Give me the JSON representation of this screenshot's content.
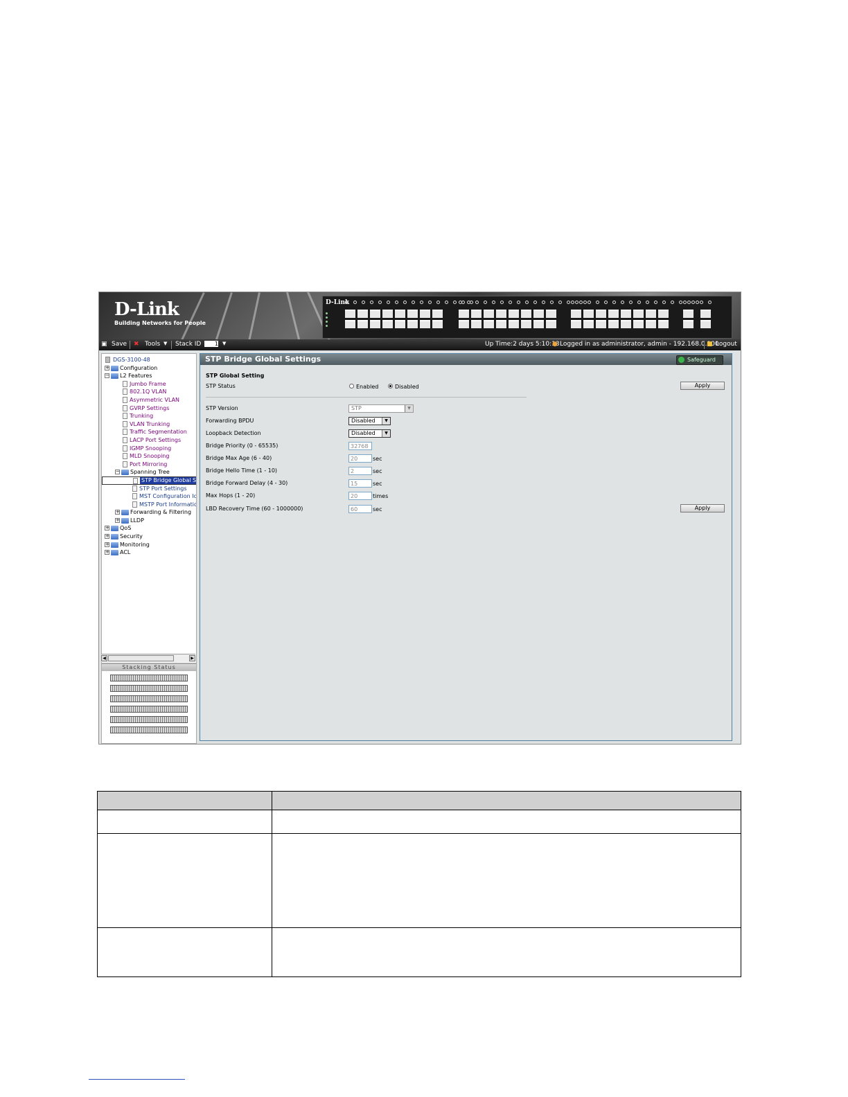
{
  "banner": {
    "logo": "D-Link",
    "tagline": "Building Networks for People",
    "device_brand": "D-Link"
  },
  "toolbar": {
    "save": "Save",
    "tools": "Tools",
    "stack_id_label": "Stack ID",
    "stack_id_value": "1",
    "uptime": "Up Time:2 days 5:10:13",
    "logged_in": "Logged in as administrator, admin - 192.168.0.100",
    "logout": "Logout"
  },
  "tree": {
    "root": "DGS-3100-48",
    "configuration": "Configuration",
    "l2features": "L2 Features",
    "jumbo": "Jumbo Frame",
    "vlan": "802.1Q VLAN",
    "asym": "Asymmetric VLAN",
    "gvrp": "GVRP Settings",
    "trunking": "Trunking",
    "vlantrunk": "VLAN Trunking",
    "traffic": "Traffic Segmentation",
    "lacp": "LACP Port Settings",
    "igmp": "IGMP Snooping",
    "mld": "MLD Snooping",
    "mirror": "Port Mirroring",
    "stp": "Spanning Tree",
    "stp_bridge": "STP Bridge Global Setti",
    "stp_port": "STP Port Settings",
    "mst_conf": "MST Configuration Ider",
    "mstp_port": "MSTP Port Information",
    "fwd": "Forwarding & Filtering",
    "lldp": "LLDP",
    "qos": "QoS",
    "security": "Security",
    "monitoring": "Monitoring",
    "acl": "ACL"
  },
  "stacking": {
    "header": "Stacking Status"
  },
  "panel": {
    "title": "STP Bridge Global Settings",
    "safeguard": "Safeguard",
    "section": "STP Global Setting",
    "status_label": "STP Status",
    "enabled": "Enabled",
    "disabled": "Disabled",
    "apply": "Apply",
    "version_label": "STP Version",
    "version_value": "STP",
    "fwd_bpdu_label": "Forwarding BPDU",
    "fwd_bpdu_value": "Disabled",
    "loopback_label": "Loopback Detection",
    "loopback_value": "Disabled",
    "priority_label": "Bridge Priority (0 - 65535)",
    "priority_value": "32768",
    "maxage_label": "Bridge Max Age (6 - 40)",
    "maxage_value": "20",
    "hello_label": "Bridge Hello Time (1 - 10)",
    "hello_value": "2",
    "fwddelay_label": "Bridge Forward  Delay (4 - 30)",
    "fwddelay_value": "15",
    "maxhops_label": "Max Hops (1 - 20)",
    "maxhops_value": "20",
    "lbd_label": "LBD Recovery Time (60 - 1000000)",
    "lbd_value": "60",
    "sec": "sec",
    "times": "times"
  }
}
